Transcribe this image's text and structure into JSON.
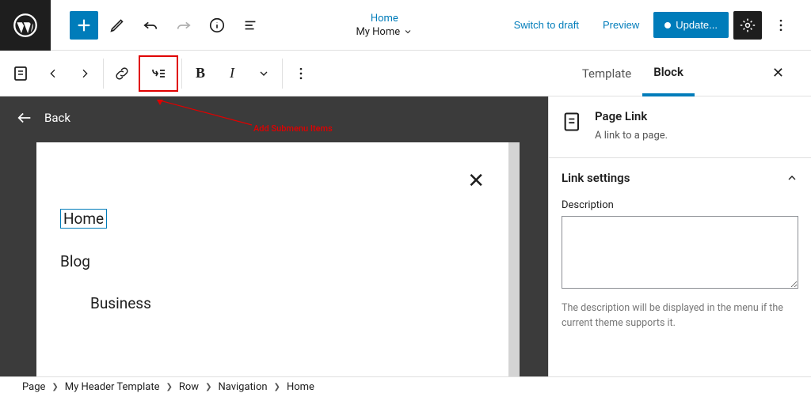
{
  "topbar": {
    "home_link": "Home",
    "doc_title": "My Home",
    "switch_draft": "Switch to draft",
    "preview": "Preview",
    "update": "Update..."
  },
  "toolbar2_tabs": {
    "template": "Template",
    "block": "Block"
  },
  "annotation": "Add Submenu Items",
  "canvas": {
    "back": "Back",
    "items": [
      "Home",
      "Blog",
      "Business"
    ]
  },
  "sidebar": {
    "block_title": "Page Link",
    "block_desc": "A link to a page.",
    "panel_title": "Link settings",
    "desc_label": "Description",
    "desc_value": "",
    "desc_help": "The description will be displayed in the menu if the current theme supports it."
  },
  "breadcrumb": [
    "Page",
    "My Header Template",
    "Row",
    "Navigation",
    "Home"
  ]
}
